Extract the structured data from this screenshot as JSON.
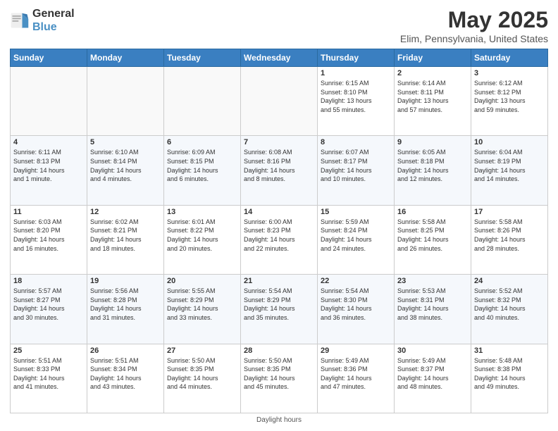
{
  "header": {
    "logo_line1": "General",
    "logo_line2": "Blue",
    "month_title": "May 2025",
    "location": "Elim, Pennsylvania, United States"
  },
  "days_of_week": [
    "Sunday",
    "Monday",
    "Tuesday",
    "Wednesday",
    "Thursday",
    "Friday",
    "Saturday"
  ],
  "weeks": [
    [
      {
        "day": "",
        "info": ""
      },
      {
        "day": "",
        "info": ""
      },
      {
        "day": "",
        "info": ""
      },
      {
        "day": "",
        "info": ""
      },
      {
        "day": "1",
        "info": "Sunrise: 6:15 AM\nSunset: 8:10 PM\nDaylight: 13 hours\nand 55 minutes."
      },
      {
        "day": "2",
        "info": "Sunrise: 6:14 AM\nSunset: 8:11 PM\nDaylight: 13 hours\nand 57 minutes."
      },
      {
        "day": "3",
        "info": "Sunrise: 6:12 AM\nSunset: 8:12 PM\nDaylight: 13 hours\nand 59 minutes."
      }
    ],
    [
      {
        "day": "4",
        "info": "Sunrise: 6:11 AM\nSunset: 8:13 PM\nDaylight: 14 hours\nand 1 minute."
      },
      {
        "day": "5",
        "info": "Sunrise: 6:10 AM\nSunset: 8:14 PM\nDaylight: 14 hours\nand 4 minutes."
      },
      {
        "day": "6",
        "info": "Sunrise: 6:09 AM\nSunset: 8:15 PM\nDaylight: 14 hours\nand 6 minutes."
      },
      {
        "day": "7",
        "info": "Sunrise: 6:08 AM\nSunset: 8:16 PM\nDaylight: 14 hours\nand 8 minutes."
      },
      {
        "day": "8",
        "info": "Sunrise: 6:07 AM\nSunset: 8:17 PM\nDaylight: 14 hours\nand 10 minutes."
      },
      {
        "day": "9",
        "info": "Sunrise: 6:05 AM\nSunset: 8:18 PM\nDaylight: 14 hours\nand 12 minutes."
      },
      {
        "day": "10",
        "info": "Sunrise: 6:04 AM\nSunset: 8:19 PM\nDaylight: 14 hours\nand 14 minutes."
      }
    ],
    [
      {
        "day": "11",
        "info": "Sunrise: 6:03 AM\nSunset: 8:20 PM\nDaylight: 14 hours\nand 16 minutes."
      },
      {
        "day": "12",
        "info": "Sunrise: 6:02 AM\nSunset: 8:21 PM\nDaylight: 14 hours\nand 18 minutes."
      },
      {
        "day": "13",
        "info": "Sunrise: 6:01 AM\nSunset: 8:22 PM\nDaylight: 14 hours\nand 20 minutes."
      },
      {
        "day": "14",
        "info": "Sunrise: 6:00 AM\nSunset: 8:23 PM\nDaylight: 14 hours\nand 22 minutes."
      },
      {
        "day": "15",
        "info": "Sunrise: 5:59 AM\nSunset: 8:24 PM\nDaylight: 14 hours\nand 24 minutes."
      },
      {
        "day": "16",
        "info": "Sunrise: 5:58 AM\nSunset: 8:25 PM\nDaylight: 14 hours\nand 26 minutes."
      },
      {
        "day": "17",
        "info": "Sunrise: 5:58 AM\nSunset: 8:26 PM\nDaylight: 14 hours\nand 28 minutes."
      }
    ],
    [
      {
        "day": "18",
        "info": "Sunrise: 5:57 AM\nSunset: 8:27 PM\nDaylight: 14 hours\nand 30 minutes."
      },
      {
        "day": "19",
        "info": "Sunrise: 5:56 AM\nSunset: 8:28 PM\nDaylight: 14 hours\nand 31 minutes."
      },
      {
        "day": "20",
        "info": "Sunrise: 5:55 AM\nSunset: 8:29 PM\nDaylight: 14 hours\nand 33 minutes."
      },
      {
        "day": "21",
        "info": "Sunrise: 5:54 AM\nSunset: 8:29 PM\nDaylight: 14 hours\nand 35 minutes."
      },
      {
        "day": "22",
        "info": "Sunrise: 5:54 AM\nSunset: 8:30 PM\nDaylight: 14 hours\nand 36 minutes."
      },
      {
        "day": "23",
        "info": "Sunrise: 5:53 AM\nSunset: 8:31 PM\nDaylight: 14 hours\nand 38 minutes."
      },
      {
        "day": "24",
        "info": "Sunrise: 5:52 AM\nSunset: 8:32 PM\nDaylight: 14 hours\nand 40 minutes."
      }
    ],
    [
      {
        "day": "25",
        "info": "Sunrise: 5:51 AM\nSunset: 8:33 PM\nDaylight: 14 hours\nand 41 minutes."
      },
      {
        "day": "26",
        "info": "Sunrise: 5:51 AM\nSunset: 8:34 PM\nDaylight: 14 hours\nand 43 minutes."
      },
      {
        "day": "27",
        "info": "Sunrise: 5:50 AM\nSunset: 8:35 PM\nDaylight: 14 hours\nand 44 minutes."
      },
      {
        "day": "28",
        "info": "Sunrise: 5:50 AM\nSunset: 8:35 PM\nDaylight: 14 hours\nand 45 minutes."
      },
      {
        "day": "29",
        "info": "Sunrise: 5:49 AM\nSunset: 8:36 PM\nDaylight: 14 hours\nand 47 minutes."
      },
      {
        "day": "30",
        "info": "Sunrise: 5:49 AM\nSunset: 8:37 PM\nDaylight: 14 hours\nand 48 minutes."
      },
      {
        "day": "31",
        "info": "Sunrise: 5:48 AM\nSunset: 8:38 PM\nDaylight: 14 hours\nand 49 minutes."
      }
    ]
  ],
  "footer": {
    "daylight_label": "Daylight hours"
  }
}
